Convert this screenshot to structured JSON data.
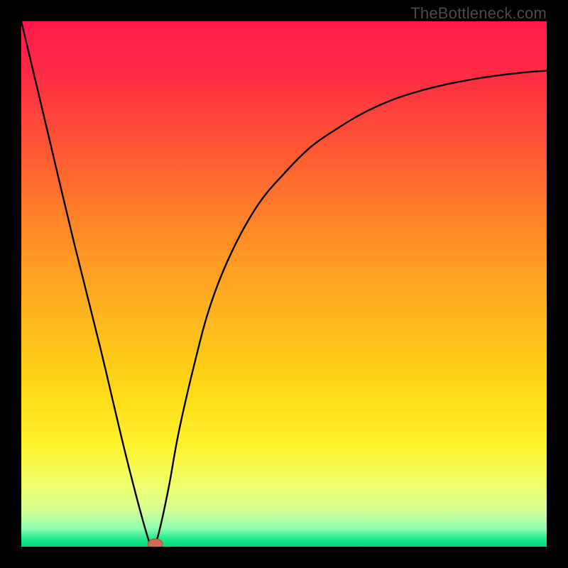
{
  "watermark": "TheBottleneck.com",
  "colors": {
    "frame": "#000000",
    "curve": "#000000",
    "marker_fill": "#cf6a55",
    "marker_stroke": "#a64b3a",
    "gradient_stops": [
      {
        "offset": 0.0,
        "color": "#ff1a4b"
      },
      {
        "offset": 0.1,
        "color": "#ff2b44"
      },
      {
        "offset": 0.25,
        "color": "#ff5a33"
      },
      {
        "offset": 0.4,
        "color": "#ff8a28"
      },
      {
        "offset": 0.55,
        "color": "#ffb31f"
      },
      {
        "offset": 0.7,
        "color": "#ffd815"
      },
      {
        "offset": 0.8,
        "color": "#fff22a"
      },
      {
        "offset": 0.88,
        "color": "#f2ff6a"
      },
      {
        "offset": 0.93,
        "color": "#d6ff93"
      },
      {
        "offset": 0.965,
        "color": "#8fffb0"
      },
      {
        "offset": 0.985,
        "color": "#20e88f"
      },
      {
        "offset": 1.0,
        "color": "#00d878"
      }
    ]
  },
  "chart_data": {
    "type": "line",
    "title": "",
    "xlabel": "",
    "ylabel": "",
    "xlim": [
      0,
      100
    ],
    "ylim": [
      0,
      100
    ],
    "grid": false,
    "legend": false,
    "series": [
      {
        "name": "bottleneck-curve",
        "x": [
          0,
          5,
          10,
          15,
          20,
          24,
          25,
          26,
          28,
          30,
          33,
          36,
          40,
          45,
          50,
          55,
          60,
          65,
          70,
          75,
          80,
          85,
          90,
          95,
          100
        ],
        "y": [
          100,
          79,
          58,
          38,
          17,
          2,
          0.5,
          2,
          11,
          22,
          35,
          46,
          56,
          65,
          71,
          76,
          79.5,
          82.5,
          84.8,
          86.5,
          87.8,
          88.8,
          89.6,
          90.2,
          90.6
        ]
      }
    ],
    "marker": {
      "x": 25.5,
      "y": 0.5,
      "rx": 1.4,
      "ry": 1.0
    },
    "annotations": []
  }
}
